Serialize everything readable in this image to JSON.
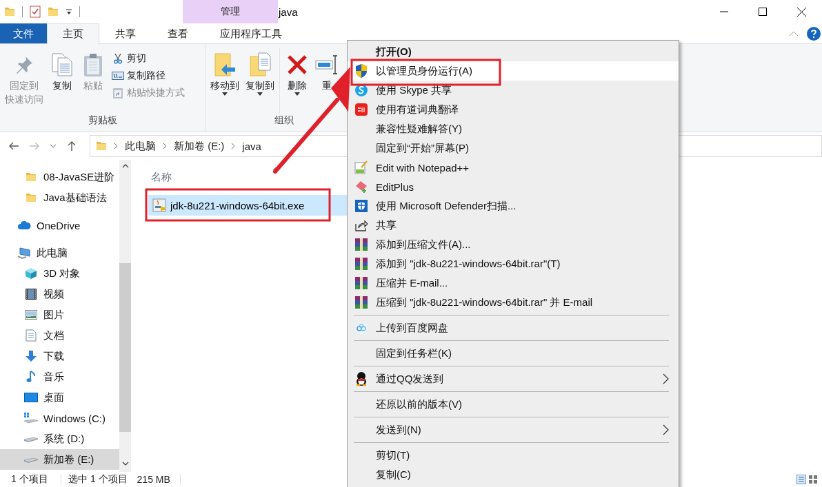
{
  "title_bar": {
    "context_tab": "管理",
    "title": "java"
  },
  "ribbon_tabs": [
    {
      "label": "文件",
      "kind": "file",
      "selected": false
    },
    {
      "label": "主页",
      "kind": "tab",
      "selected": true
    },
    {
      "label": "共享",
      "kind": "tab",
      "selected": false
    },
    {
      "label": "查看",
      "kind": "tab",
      "selected": false
    },
    {
      "label": "应用程序工具",
      "kind": "tab",
      "selected": false
    }
  ],
  "ribbon": {
    "groups": [
      {
        "label": "剪贴板",
        "sections": [
          [
            {
              "kind": "large",
              "lines": [
                "固定到",
                "快速访问"
              ],
              "disabled": true,
              "dropdown": false
            },
            {
              "kind": "large",
              "lines": [
                "复制"
              ],
              "disabled": false,
              "dropdown": false
            },
            {
              "kind": "large",
              "lines": [
                "粘贴"
              ],
              "disabled": true,
              "dropdown": false
            },
            {
              "kind": "small",
              "lines": [
                "剪切"
              ],
              "disabled": false
            },
            {
              "kind": "small",
              "lines": [
                "复制路径"
              ],
              "disabled": false
            },
            {
              "kind": "small",
              "lines": [
                "粘贴快捷方式"
              ],
              "disabled": true
            }
          ]
        ]
      },
      {
        "label": "组织",
        "sections": [
          [
            {
              "kind": "large",
              "lines": [
                "移动到"
              ],
              "disabled": false,
              "dropdown": true
            },
            {
              "kind": "large",
              "lines": [
                "复制到"
              ],
              "disabled": false,
              "dropdown": true
            }
          ],
          [
            {
              "kind": "large",
              "lines": [
                "删除"
              ],
              "disabled": false,
              "dropdown": true
            },
            {
              "kind": "large",
              "lines": [
                "重"
              ],
              "disabled": false,
              "dropdown": false
            }
          ]
        ]
      }
    ]
  },
  "navigation": [
    {
      "kind": "back",
      "disabled": false
    },
    {
      "kind": "forward",
      "disabled": true
    },
    {
      "kind": "recent",
      "disabled": false
    },
    {
      "kind": "up",
      "disabled": false
    }
  ],
  "address_bar": {
    "path": [
      "此电脑",
      "新加卷 (E:)",
      "java"
    ]
  },
  "nav_pane": {
    "quick_access": [
      {
        "label": "08-JavaSE进阶",
        "selected": false
      },
      {
        "label": "Java基础语法",
        "selected": false
      }
    ],
    "tree": [
      {
        "label": "OneDrive",
        "selected": false
      },
      {
        "label": "此电脑",
        "selected": false,
        "children": [
          {
            "label": "3D 对象",
            "selected": false
          },
          {
            "label": "视频",
            "selected": false
          },
          {
            "label": "图片",
            "selected": false
          },
          {
            "label": "文档",
            "selected": false
          },
          {
            "label": "下载",
            "selected": false
          },
          {
            "label": "音乐",
            "selected": false
          },
          {
            "label": "桌面",
            "selected": false
          },
          {
            "label": "Windows (C:)",
            "selected": false
          },
          {
            "label": "系统 (D:)",
            "selected": false
          },
          {
            "label": "新加卷 (E:)",
            "selected": true
          }
        ]
      }
    ]
  },
  "file_list": {
    "columns": [
      "名称"
    ],
    "files": [
      {
        "name": "jdk-8u221-windows-64bit.exe",
        "selected": true
      }
    ]
  },
  "status_bar": {
    "item_count": "1 个项目",
    "selection": "选中 1 个项目",
    "size": "215 MB"
  },
  "context_menu": {
    "items": [
      {
        "kind": "item",
        "label": "打开(O)",
        "default": true,
        "hovered": false,
        "submenu": false
      },
      {
        "kind": "item",
        "label": "以管理员身份运行(A)",
        "default": false,
        "hovered": true,
        "submenu": false
      },
      {
        "kind": "item",
        "label": "使用 Skype 共享",
        "default": false,
        "hovered": false,
        "submenu": false
      },
      {
        "kind": "item",
        "label": "使用有道词典翻译",
        "default": false,
        "hovered": false,
        "submenu": false
      },
      {
        "kind": "item",
        "label": "兼容性疑难解答(Y)",
        "default": false,
        "hovered": false,
        "submenu": false
      },
      {
        "kind": "item",
        "label": "固定到“开始”屏幕(P)",
        "default": false,
        "hovered": false,
        "submenu": false
      },
      {
        "kind": "item",
        "label": "Edit with Notepad++",
        "default": false,
        "hovered": false,
        "submenu": false
      },
      {
        "kind": "item",
        "label": "EditPlus",
        "default": false,
        "hovered": false,
        "submenu": false
      },
      {
        "kind": "item",
        "label": "使用 Microsoft Defender扫描...",
        "default": false,
        "hovered": false,
        "submenu": false
      },
      {
        "kind": "item",
        "label": "共享",
        "default": false,
        "hovered": false,
        "submenu": false
      },
      {
        "kind": "item",
        "label": "添加到压缩文件(A)...",
        "default": false,
        "hovered": false,
        "submenu": false
      },
      {
        "kind": "item",
        "label": "添加到 \"jdk-8u221-windows-64bit.rar\"(T)",
        "default": false,
        "hovered": false,
        "submenu": false
      },
      {
        "kind": "item",
        "label": "压缩并 E-mail...",
        "default": false,
        "hovered": false,
        "submenu": false
      },
      {
        "kind": "item",
        "label": "压缩到 \"jdk-8u221-windows-64bit.rar\" 并 E-mail",
        "default": false,
        "hovered": false,
        "submenu": false
      },
      {
        "kind": "separator"
      },
      {
        "kind": "item",
        "label": "上传到百度网盘",
        "default": false,
        "hovered": false,
        "submenu": false
      },
      {
        "kind": "separator"
      },
      {
        "kind": "item",
        "label": "固定到任务栏(K)",
        "default": false,
        "hovered": false,
        "submenu": false
      },
      {
        "kind": "separator"
      },
      {
        "kind": "item",
        "label": "通过QQ发送到",
        "default": false,
        "hovered": false,
        "submenu": true
      },
      {
        "kind": "separator"
      },
      {
        "kind": "item",
        "label": "还原以前的版本(V)",
        "default": false,
        "hovered": false,
        "submenu": false
      },
      {
        "kind": "separator"
      },
      {
        "kind": "item",
        "label": "发送到(N)",
        "default": false,
        "hovered": false,
        "submenu": true
      },
      {
        "kind": "separator"
      },
      {
        "kind": "item",
        "label": "剪切(T)",
        "default": false,
        "hovered": false,
        "submenu": false
      },
      {
        "kind": "item",
        "label": "复制(C)",
        "default": false,
        "hovered": false,
        "submenu": false
      }
    ]
  }
}
